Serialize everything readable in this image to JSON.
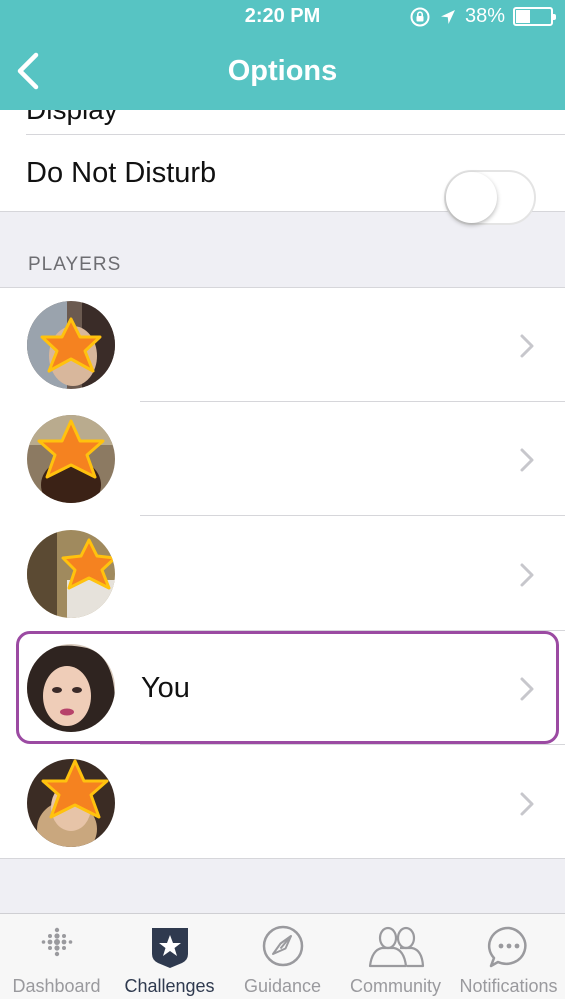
{
  "status_bar": {
    "time": "2:20 PM",
    "battery_text": "38%",
    "battery_level": 0.38
  },
  "nav": {
    "title": "Options"
  },
  "settings": {
    "partial_row_label": "Display",
    "do_not_disturb": {
      "label": "Do Not Disturb",
      "enabled": false
    }
  },
  "players_section": {
    "header": "PLAYERS",
    "players": [
      {
        "name": "",
        "avatar": "starred-avatar"
      },
      {
        "name": "",
        "avatar": "starred-avatar"
      },
      {
        "name": "",
        "avatar": "starred-avatar"
      },
      {
        "name": "You",
        "avatar": "user-avatar",
        "highlighted": true
      },
      {
        "name": "",
        "avatar": "starred-avatar"
      }
    ]
  },
  "tabbar": {
    "tabs": [
      {
        "label": "Dashboard",
        "icon": "dots-grid-icon",
        "active": false
      },
      {
        "label": "Challenges",
        "icon": "star-badge-icon",
        "active": true
      },
      {
        "label": "Guidance",
        "icon": "compass-icon",
        "active": false
      },
      {
        "label": "Community",
        "icon": "people-icon",
        "active": false
      },
      {
        "label": "Notifications",
        "icon": "chat-bubble-icon",
        "active": false
      }
    ]
  },
  "colors": {
    "header": "#57c4c3",
    "highlight": "#9b4aa2",
    "star_fill": "#f58220",
    "star_stroke": "#ffc20e"
  }
}
